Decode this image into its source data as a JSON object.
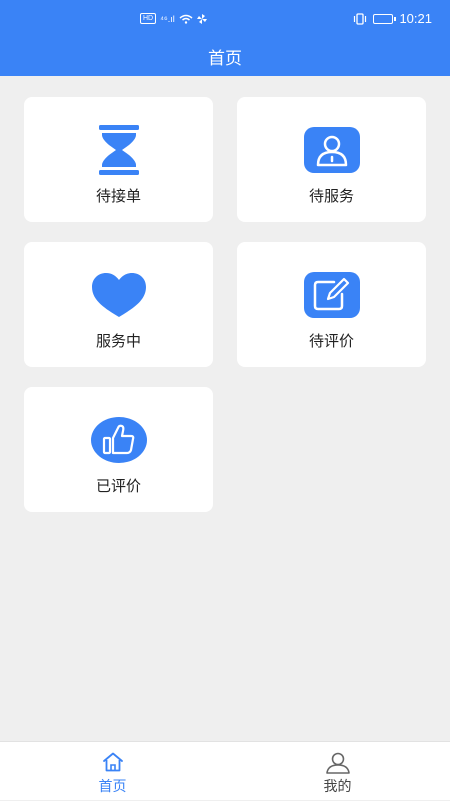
{
  "status_bar": {
    "left_badge": "HD",
    "signal_text": "⁴⁶.ıl",
    "time": "10:21"
  },
  "header": {
    "title": "首页"
  },
  "cards": [
    {
      "label": "待接单",
      "icon": "hourglass-icon"
    },
    {
      "label": "待服务",
      "icon": "user-badge-icon"
    },
    {
      "label": "服务中",
      "icon": "heart-icon"
    },
    {
      "label": "待评价",
      "icon": "edit-icon"
    },
    {
      "label": "已评价",
      "icon": "thumbs-up-icon"
    }
  ],
  "tabbar": {
    "items": [
      {
        "label": "首页",
        "icon": "home-icon",
        "active": true
      },
      {
        "label": "我的",
        "icon": "person-icon",
        "active": false
      }
    ]
  },
  "colors": {
    "brand": "#3a83f6",
    "background": "#efefef",
    "tab_inactive": "#666666"
  }
}
